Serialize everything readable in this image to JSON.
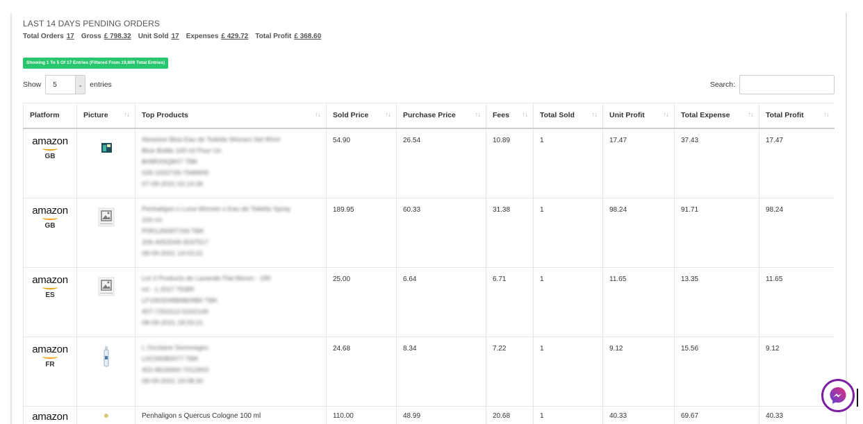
{
  "summary": {
    "title": "LAST 14 DAYS PENDING ORDERS",
    "total_orders_label": "Total Orders",
    "total_orders_value": "17",
    "gross_label": "Gross",
    "gross_value": "£ 798.32",
    "unit_sold_label": "Unit Sold",
    "unit_sold_value": "17",
    "expenses_label": "Expenses",
    "expenses_value": "£ 429.72",
    "total_profit_label": "Total Profit",
    "total_profit_value": "£ 368.60"
  },
  "info": "Showing 1 To 5 Of 17 Entries (Filtered From 19,809 Total Entries)",
  "length": {
    "show_label": "Show",
    "value": "5",
    "entries_label": "entries"
  },
  "search": {
    "label": "Search:",
    "value": ""
  },
  "columns": [
    "Platform",
    "Picture",
    "Top Products",
    "Sold Price",
    "Purchase Price",
    "Fees",
    "Total Sold",
    "Unit Profit",
    "Total Expense",
    "Total Profit"
  ],
  "sort_icon": "↑↓",
  "rows": [
    {
      "platform": "amazon",
      "country": "GB",
      "thumb": "product-box-icon",
      "product_lines": [
        "Abrasive Bisa Eau de Toilette Women Set 80ml",
        "Blue Bottle 100 ml Pour Un",
        "B09RX9Q8X7 TBK",
        "026-1002735-7948905",
        "07-09-2021 02:14:36"
      ],
      "sold_price": "54.90",
      "purchase_price": "26.54",
      "fees": "10.89",
      "total_sold": "1",
      "unit_profit": "17.47",
      "total_expense": "37.43",
      "total_profit": "17.47"
    },
    {
      "platform": "amazon",
      "country": "GB",
      "thumb": "image-placeholder-icon",
      "product_lines": [
        "Penhaligon s Luna Women s Eau de Toilette Spray",
        "100 ml",
        "P0R1JN09T7A9 TBK",
        "206-4052049-3037517",
        "08-09-2021 14:03:21"
      ],
      "sold_price": "189.95",
      "purchase_price": "60.33",
      "fees": "31.38",
      "total_sold": "1",
      "unit_profit": "98.24",
      "total_expense": "91.71",
      "total_profit": "98.24"
    },
    {
      "platform": "amazon",
      "country": "ES",
      "thumb": "image-placeholder-icon",
      "product_lines": [
        "Lot 3 Products de Lavande Flat Meren - 180",
        "ml - 1 2017 TEBR",
        "LF1903048B9B09B0 TBK",
        "407-7253112-6162149",
        "08-09-2021 18:03:21"
      ],
      "sold_price": "25.00",
      "purchase_price": "6.64",
      "fees": "6.71",
      "total_sold": "1",
      "unit_profit": "11.65",
      "total_expense": "13.35",
      "total_profit": "11.65"
    },
    {
      "platform": "amazon",
      "country": "FR",
      "thumb": "spray-bottle-icon",
      "product_lines": [
        "L Occitane Sommeges",
        "L0C090B0077 TBK",
        "402-8618460-7012903",
        "08-09-2021 19:08:30"
      ],
      "sold_price": "24.68",
      "purchase_price": "8.34",
      "fees": "7.22",
      "total_sold": "1",
      "unit_profit": "9.12",
      "total_expense": "15.56",
      "total_profit": "9.12"
    },
    {
      "platform": "amazon",
      "country": "",
      "thumb": "flower-icon",
      "product_lines": [
        "Penhaligon s Quercus Cologne 100 ml"
      ],
      "sold_price": "110.00",
      "purchase_price": "48.99",
      "fees": "20.68",
      "total_sold": "1",
      "unit_profit": "40.33",
      "total_expense": "69.67",
      "total_profit": "40.33"
    }
  ]
}
